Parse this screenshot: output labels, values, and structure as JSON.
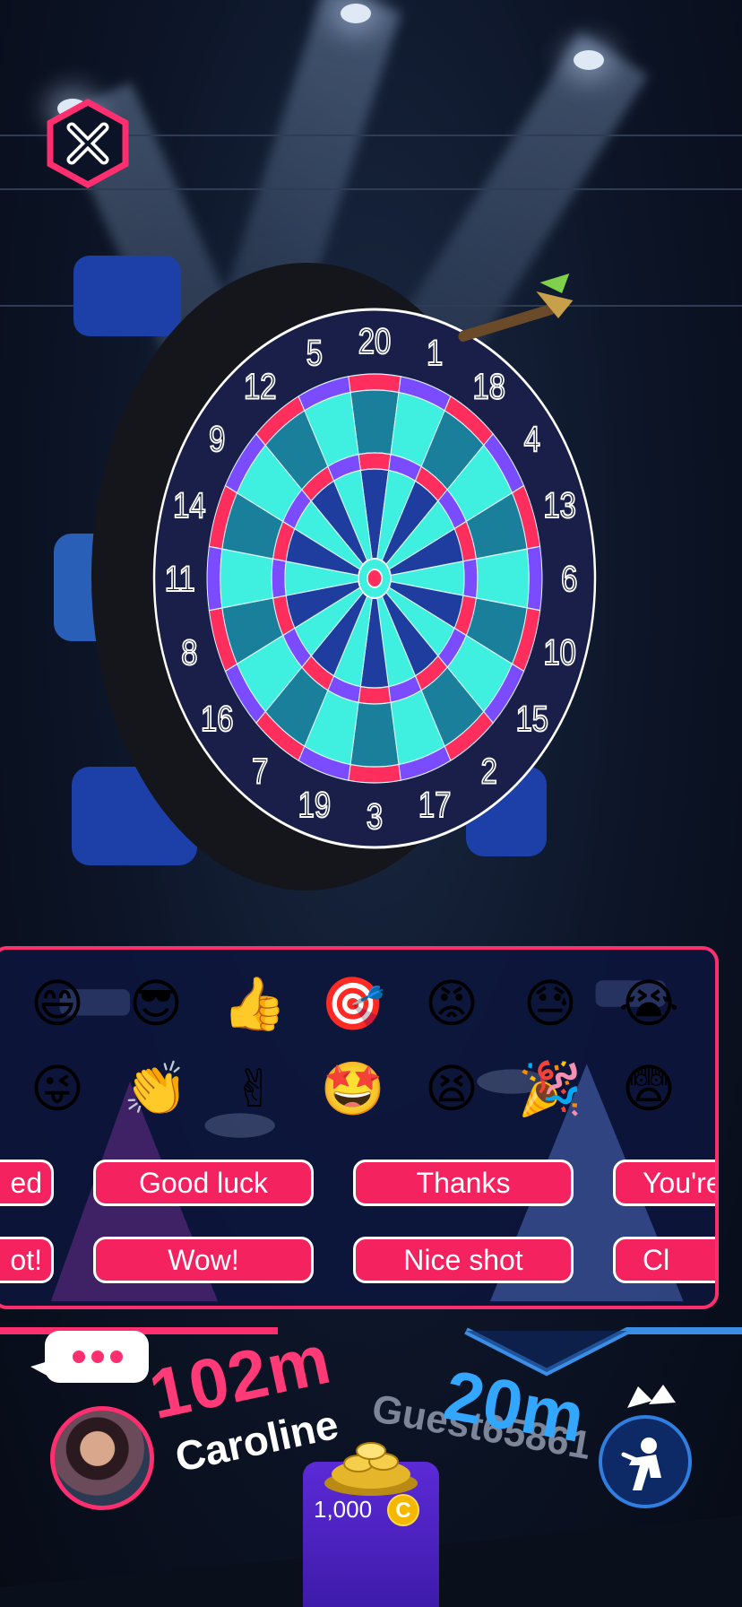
{
  "close_button": {
    "icon": "close-icon"
  },
  "dartboard": {
    "numbers": [
      "20",
      "1",
      "18",
      "4",
      "13",
      "6",
      "10",
      "15",
      "2",
      "17",
      "3",
      "19",
      "7",
      "16",
      "8",
      "11",
      "14",
      "9",
      "12",
      "5"
    ],
    "colors": {
      "rim": "#1a1f4a",
      "ring_red": "#ff2e5c",
      "ring_purple": "#7a4bff",
      "cyan": "#3ff0e0",
      "dark_blue": "#1f3d9e"
    }
  },
  "chat_panel": {
    "emoji_row1": [
      {
        "icon": "grin-emoji-icon",
        "glyph": "😄"
      },
      {
        "icon": "sunglasses-emoji-icon",
        "glyph": "😎"
      },
      {
        "icon": "thumbs-up-emoji-icon",
        "glyph": "👍"
      },
      {
        "icon": "target-emoji-icon",
        "glyph": "🎯"
      },
      {
        "icon": "angry-emoji-icon",
        "glyph": "😡"
      },
      {
        "icon": "downcast-sweat-emoji-icon",
        "glyph": "😓"
      },
      {
        "icon": "crying-emoji-icon",
        "glyph": "😭"
      }
    ],
    "emoji_row2": [
      {
        "icon": "tongue-wink-emoji-icon",
        "glyph": "😜"
      },
      {
        "icon": "clapping-emoji-icon",
        "glyph": "👏"
      },
      {
        "icon": "victory-hand-emoji-icon",
        "glyph": "✌"
      },
      {
        "icon": "star-eyes-emoji-icon",
        "glyph": "🤩"
      },
      {
        "icon": "tired-emoji-icon",
        "glyph": "😫"
      },
      {
        "icon": "party-popper-emoji-icon",
        "glyph": "🎉"
      },
      {
        "icon": "fearful-emoji-icon",
        "glyph": "😨"
      }
    ],
    "quick_row1": [
      "ed",
      "Good luck",
      "Thanks",
      "You're"
    ],
    "quick_row2": [
      "ot!",
      "Wow!",
      "Nice shot",
      "Cl"
    ]
  },
  "player1": {
    "distance": "102m",
    "name": "Caroline",
    "accent": "#ff3a77"
  },
  "player2": {
    "distance": "20m",
    "name": "Guest65861",
    "accent": "#33a6ff"
  },
  "coins": {
    "amount": "1,000",
    "symbol": "C"
  }
}
